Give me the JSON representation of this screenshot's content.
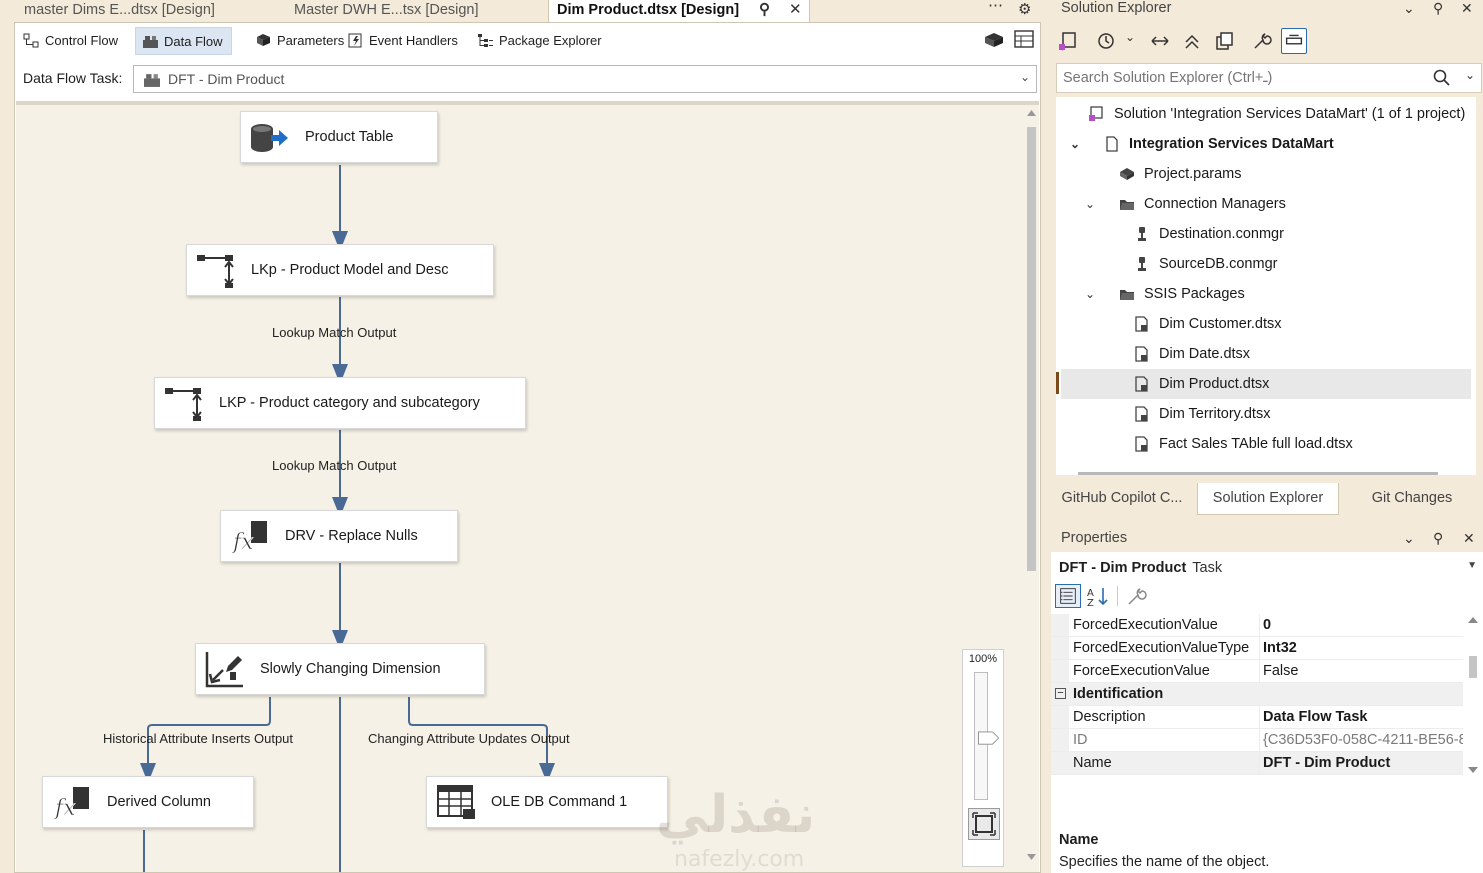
{
  "document_tabs": [
    {
      "label": "master Dims E...dtsx [Design]",
      "active": false
    },
    {
      "label": "Master DWH E...tsx [Design]",
      "active": false
    },
    {
      "label": "Dim Product.dtsx [Design]",
      "active": true
    }
  ],
  "designer_tabs": [
    {
      "label": "Control Flow",
      "active": false
    },
    {
      "label": "Data Flow",
      "active": true
    },
    {
      "label": "Parameters",
      "active": false
    },
    {
      "label": "Event Handlers",
      "active": false
    },
    {
      "label": "Package Explorer",
      "active": false
    }
  ],
  "task_selector": {
    "label": "Data Flow Task:",
    "value": "DFT - Dim Product"
  },
  "data_flow": {
    "components": [
      {
        "label": "Product Table",
        "icon": "database-source-icon"
      },
      {
        "label": "LKp - Product Model and Desc",
        "icon": "lookup-icon"
      },
      {
        "label": "LKP - Product category and subcategory",
        "icon": "lookup-icon"
      },
      {
        "label": "DRV - Replace Nulls",
        "icon": "derived-column-icon"
      },
      {
        "label": "Slowly Changing Dimension",
        "icon": "scd-icon"
      },
      {
        "label": "Derived Column",
        "icon": "derived-column-icon"
      },
      {
        "label": "OLE DB Command 1",
        "icon": "ole-db-command-icon"
      }
    ],
    "flow_labels": [
      "Lookup Match Output",
      "Lookup Match Output",
      "Historical Attribute Inserts Output",
      "Changing Attribute Updates Output"
    ],
    "zoom": "100%"
  },
  "watermark": {
    "arabic": "نفذلي",
    "latin": "nafezly.com"
  },
  "solution_explorer": {
    "title": "Solution Explorer",
    "search_placeholder": "Search Solution Explorer (Ctrl+ـ)",
    "tree": [
      {
        "label": "Solution 'Integration Services DataMart' (1 of 1 project)",
        "icon": "solution-icon",
        "level": 0
      },
      {
        "label": "Integration Services DataMart",
        "icon": "project-icon",
        "level": 1,
        "bold": true,
        "expanded": true
      },
      {
        "label": "Project.params",
        "icon": "params-icon",
        "level": 2
      },
      {
        "label": "Connection Managers",
        "icon": "folder-icon",
        "level": 2,
        "expanded": true
      },
      {
        "label": "Destination.conmgr",
        "icon": "connection-icon",
        "level": 3
      },
      {
        "label": "SourceDB.conmgr",
        "icon": "connection-icon",
        "level": 3
      },
      {
        "label": "SSIS Packages",
        "icon": "folder-icon",
        "level": 2,
        "expanded": true
      },
      {
        "label": "Dim Customer.dtsx",
        "icon": "package-icon",
        "level": 3
      },
      {
        "label": "Dim Date.dtsx",
        "icon": "package-icon",
        "level": 3
      },
      {
        "label": "Dim Product.dtsx",
        "icon": "package-icon",
        "level": 3,
        "selected": true
      },
      {
        "label": "Dim Territory.dtsx",
        "icon": "package-icon",
        "level": 3
      },
      {
        "label": "Fact Sales TAble full load.dtsx",
        "icon": "package-icon",
        "level": 3
      }
    ]
  },
  "bottom_tabs": [
    {
      "label": "GitHub Copilot C...",
      "active": false
    },
    {
      "label": "Solution Explorer",
      "active": true
    },
    {
      "label": "Git Changes",
      "active": false
    }
  ],
  "properties": {
    "title": "Properties",
    "object_name": "DFT - Dim Product",
    "object_kind": "Task",
    "rows": [
      {
        "name": "ForcedExecutionValue",
        "value": "0",
        "style": "bold"
      },
      {
        "name": "ForcedExecutionValueType",
        "value": "Int32",
        "style": "bold"
      },
      {
        "name": "ForceExecutionValue",
        "value": "False",
        "style": ""
      },
      {
        "name": "Identification",
        "value": "",
        "style": "category"
      },
      {
        "name": "Description",
        "value": "Data Flow Task",
        "style": "bold"
      },
      {
        "name": "ID",
        "value": "{C36D53F0-058C-4211-BE56-8",
        "style": "dim"
      },
      {
        "name": "Name",
        "value": "DFT - Dim Product",
        "style": "bold"
      }
    ],
    "desc_title": "Name",
    "desc_text": "Specifies the name of the object."
  },
  "colors": {
    "accent": "#2b6cb0",
    "flow_line": "#4a6a96",
    "window_bg": "#f3ead9",
    "canvas_bg": "#f6f1e6"
  }
}
